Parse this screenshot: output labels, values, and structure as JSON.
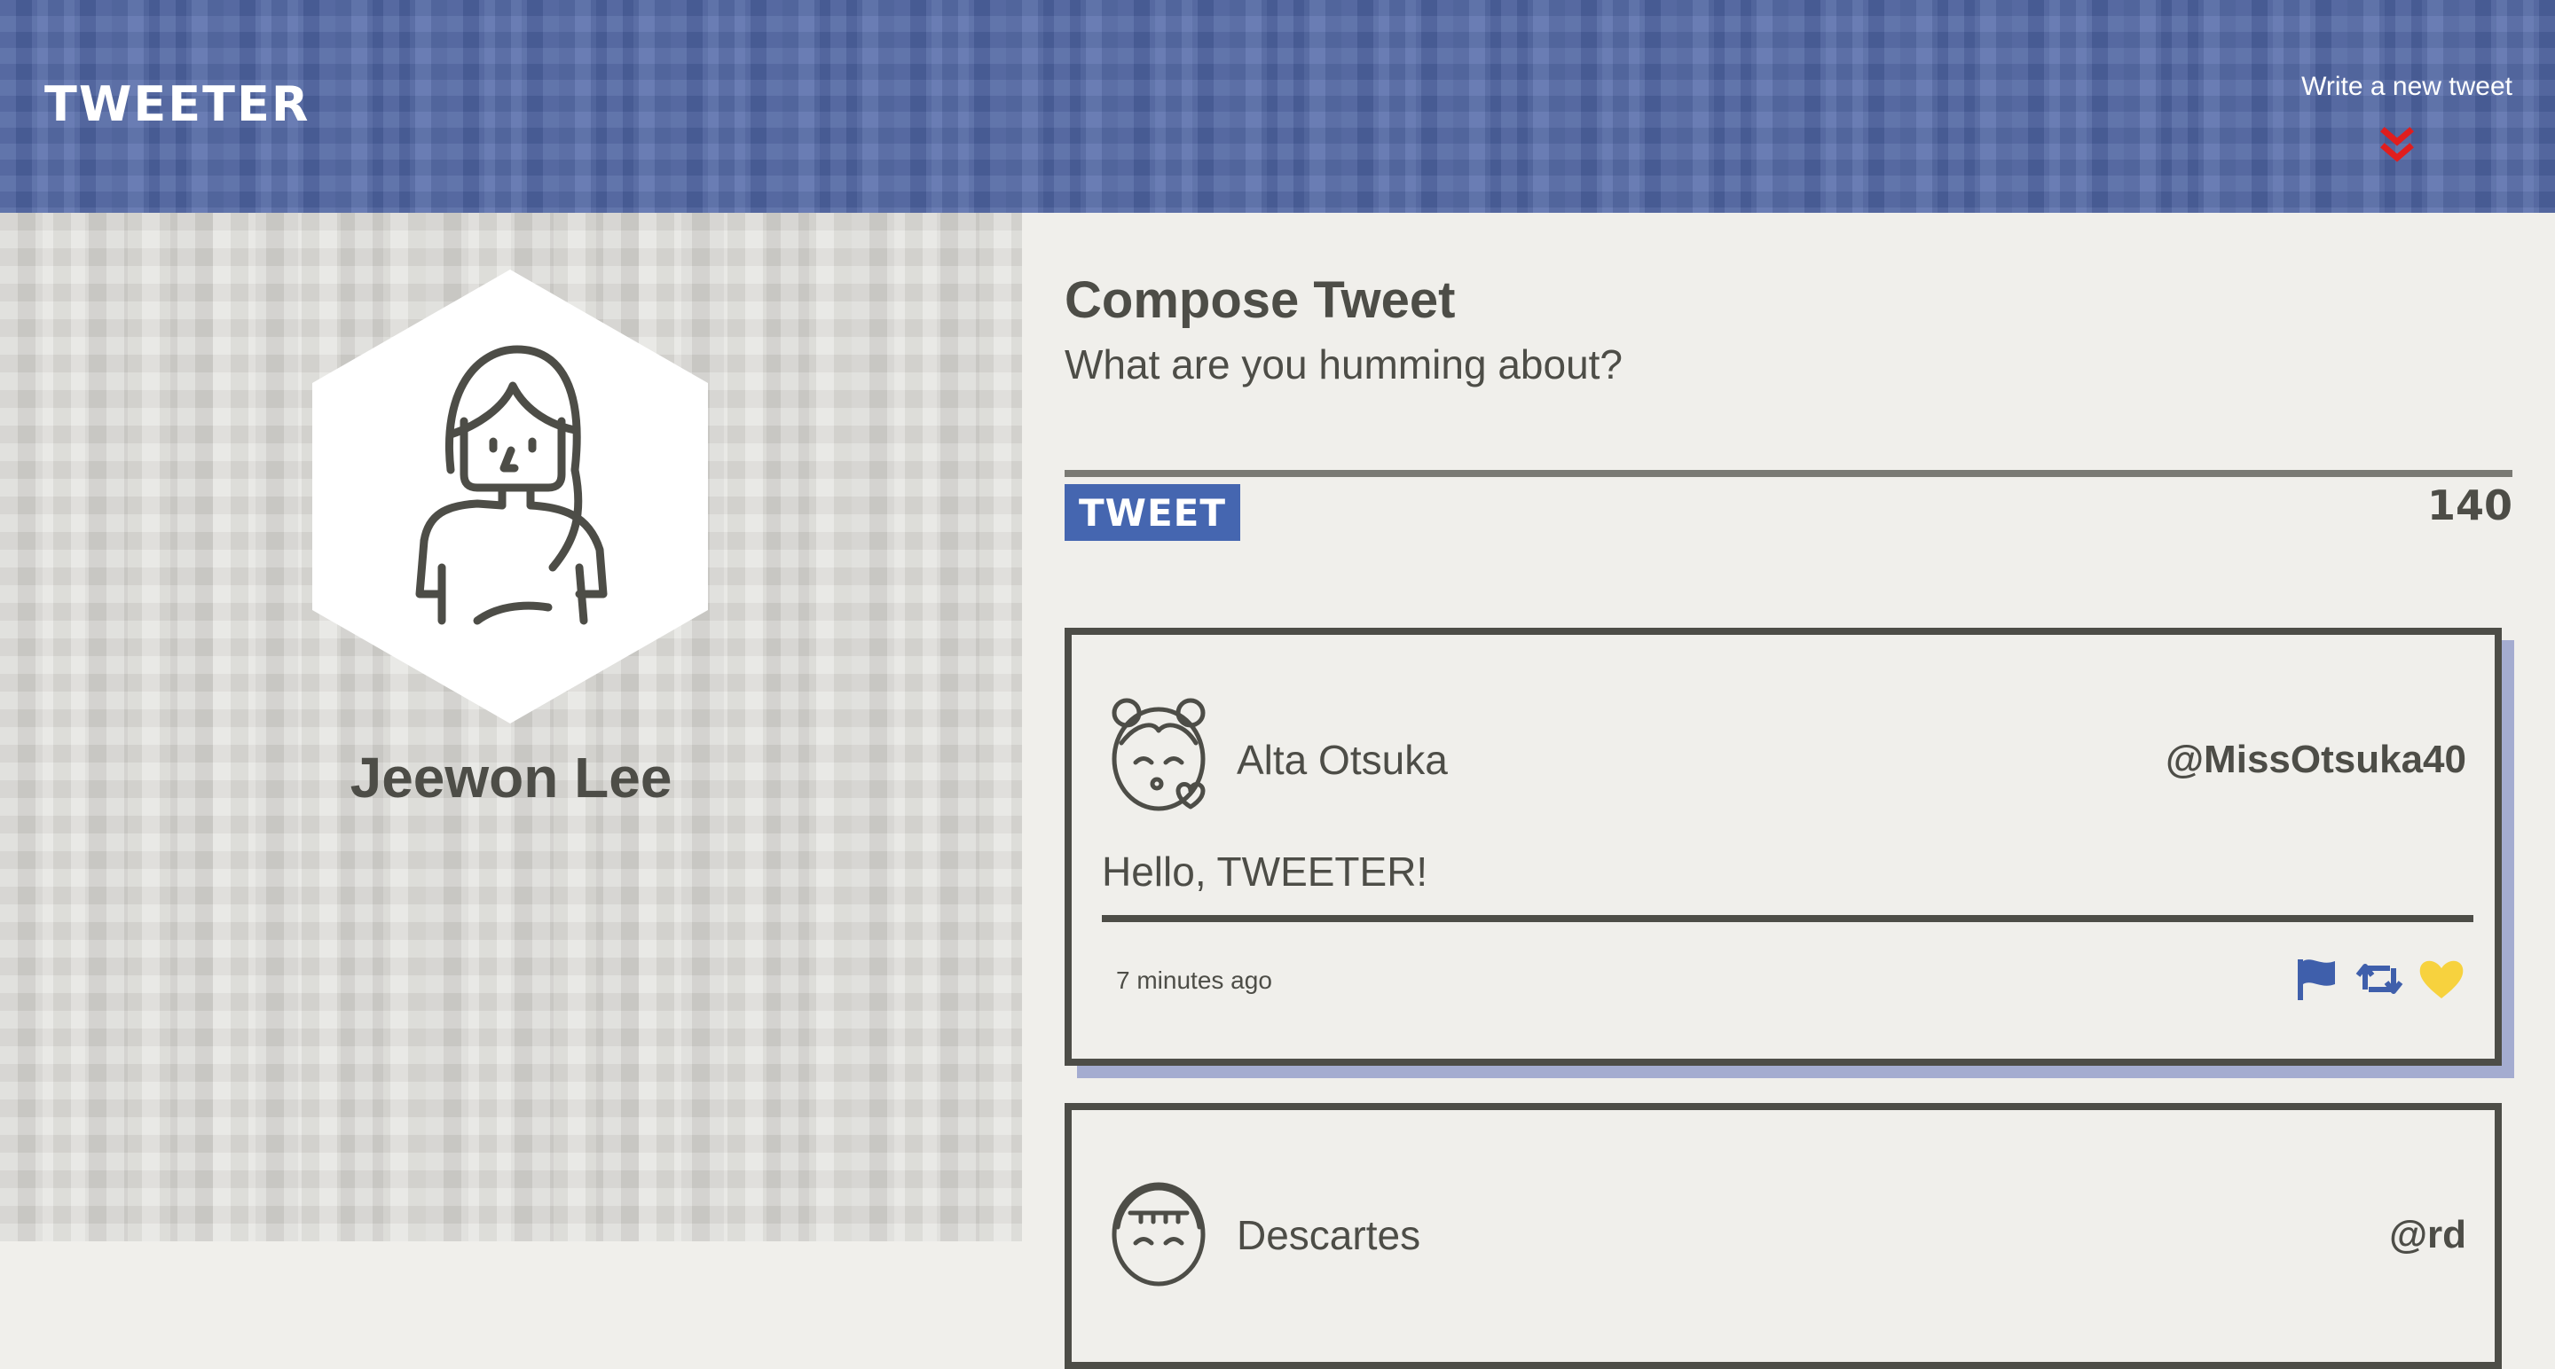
{
  "app": {
    "logo": "TWEETER"
  },
  "nav": {
    "write_toggle_label": "Write a new tweet",
    "toggle_icon": "double-chevron-down-icon"
  },
  "profile": {
    "name": "Jeewon Lee",
    "avatar_icon": "user-avatar-icon"
  },
  "compose": {
    "title": "Compose Tweet",
    "placeholder": "What are you humming about?",
    "value": "",
    "button_label": "TWEET",
    "counter": "140"
  },
  "tweets": [
    {
      "name": "Alta Otsuka",
      "handle": "@MissOtsuka40",
      "body": "Hello, TWEETER!",
      "time": "7 minutes ago",
      "actions": [
        "flag-icon",
        "retweet-icon",
        "heart-icon"
      ]
    },
    {
      "name": "Descartes",
      "handle": "@rd"
    }
  ],
  "colors": {
    "nav": "#5168a8",
    "accent": "#4566b0",
    "chevron": "#e01e1e",
    "heart": "#f7d23e",
    "text": "#4d4d47",
    "shadow": "#a4acd0"
  }
}
